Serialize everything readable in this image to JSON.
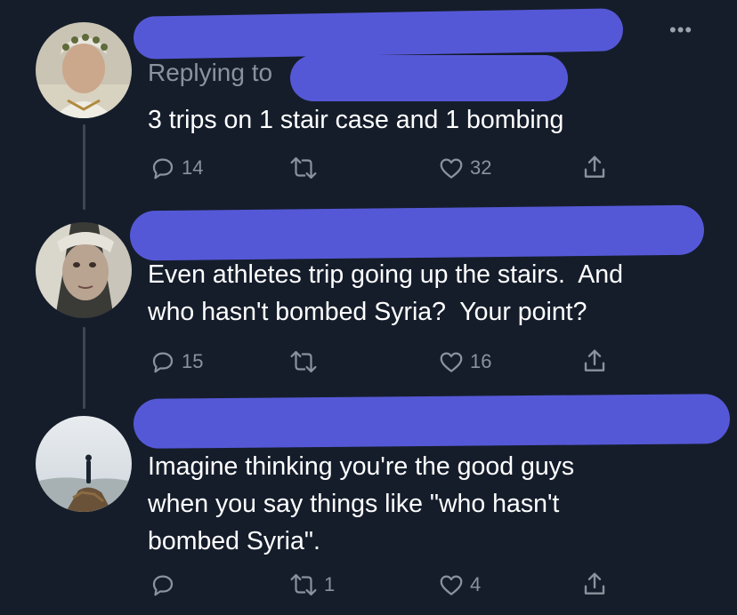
{
  "more_menu": {
    "glyph": "•••"
  },
  "tweets": [
    {
      "replying_label": "Replying to",
      "text": "3 trips on 1 stair case and 1 bombing",
      "actions": {
        "reply_count": "14",
        "retweet_count": "",
        "like_count": "32"
      }
    },
    {
      "text_lines": [
        "Even athletes trip going up the stairs.  And",
        "who hasn't bombed Syria?  Your point?"
      ],
      "actions": {
        "reply_count": "15",
        "retweet_count": "",
        "like_count": "16"
      }
    },
    {
      "text_lines": [
        "Imagine thinking you're the good guys",
        "when you say things like \"who hasn't",
        "bombed Syria\"."
      ],
      "actions": {
        "reply_count": "",
        "retweet_count": "1",
        "like_count": "4"
      }
    }
  ],
  "colors": {
    "background": "#151d2b",
    "muted_text": "#8a939d",
    "redaction": "#5558d6",
    "thread_line": "#3d4652"
  }
}
